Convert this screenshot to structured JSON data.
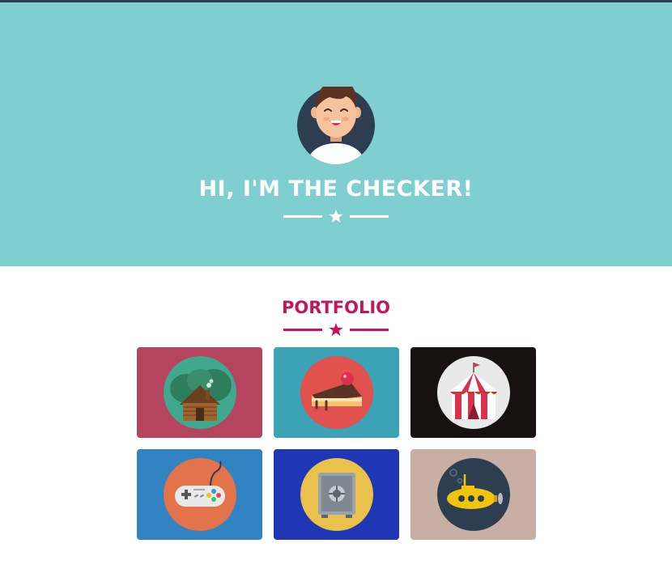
{
  "hero": {
    "title": "HI, I'M THE CHECKER!"
  },
  "portfolio": {
    "title": "PORTFOLIO",
    "items": [
      {
        "icon": "cabin-icon",
        "background": "#b5445f",
        "circle": "#40a88f"
      },
      {
        "icon": "cake-icon",
        "background": "#3ba3b5",
        "circle": "#e1514e"
      },
      {
        "icon": "circus-tent-icon",
        "background": "#171211",
        "circle": "#e9e9e9"
      },
      {
        "icon": "game-controller-icon",
        "background": "#3283c2",
        "circle": "#e3734a"
      },
      {
        "icon": "safe-icon",
        "background": "#1f37b5",
        "circle": "#eac14b"
      },
      {
        "icon": "submarine-icon",
        "background": "#c9afa3",
        "circle": "#2c3e50"
      }
    ]
  },
  "colors": {
    "hero_bg": "#80cfd0",
    "accent": "#c2185b",
    "white": "#ffffff"
  }
}
